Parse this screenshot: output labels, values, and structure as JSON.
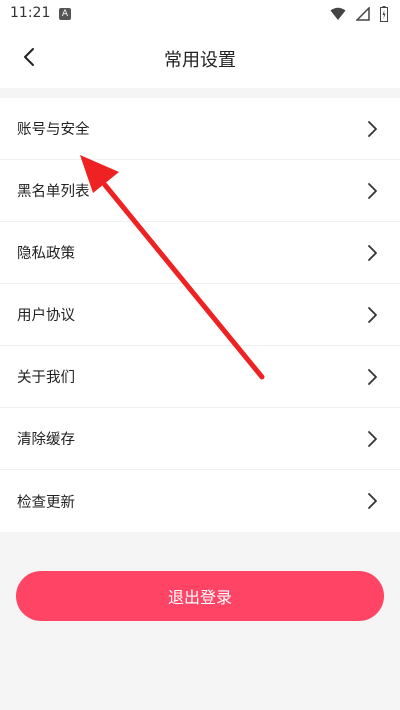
{
  "status_bar": {
    "time": "11:21",
    "a_badge": "A"
  },
  "header": {
    "title": "常用设置"
  },
  "menu": {
    "items": [
      {
        "label": "账号与安全"
      },
      {
        "label": "黑名单列表"
      },
      {
        "label": "隐私政策"
      },
      {
        "label": "用户协议"
      },
      {
        "label": "关于我们"
      },
      {
        "label": "清除缓存"
      },
      {
        "label": "检查更新"
      }
    ]
  },
  "logout": {
    "label": "退出登录"
  },
  "colors": {
    "accent": "#ff4466",
    "annotation_arrow": "#ee2222"
  }
}
